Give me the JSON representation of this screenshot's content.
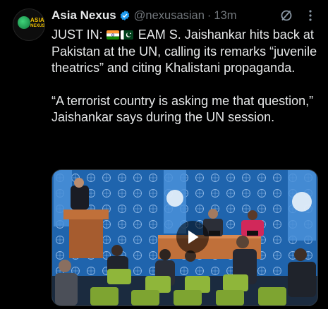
{
  "author": {
    "display_name": "Asia Nexus",
    "handle": "@nexusasian",
    "separator": "·",
    "time": "13m",
    "avatar_text_top": "ASIA",
    "avatar_text_bottom": "NEXUS"
  },
  "tweet": {
    "line1_prefix": "JUST IN:",
    "line1_rest": "EAM S. Jaishankar hits back at Pakistan at the UN, calling its remarks “juvenile theatrics” and citing Khalistani propaganda.",
    "paragraph2": "“A terrorist country is asking me that question,” Jaishankar says during the UN session.",
    "flags": [
      "india-flag-icon",
      "pakistan-flag-icon"
    ]
  },
  "colors": {
    "background": "#000000",
    "text": "#e7e9ea",
    "muted": "#71767b",
    "verified": "#1d9bf0",
    "un_blue": "#1f64ad"
  },
  "media": {
    "type": "video",
    "icon": "play-icon"
  }
}
